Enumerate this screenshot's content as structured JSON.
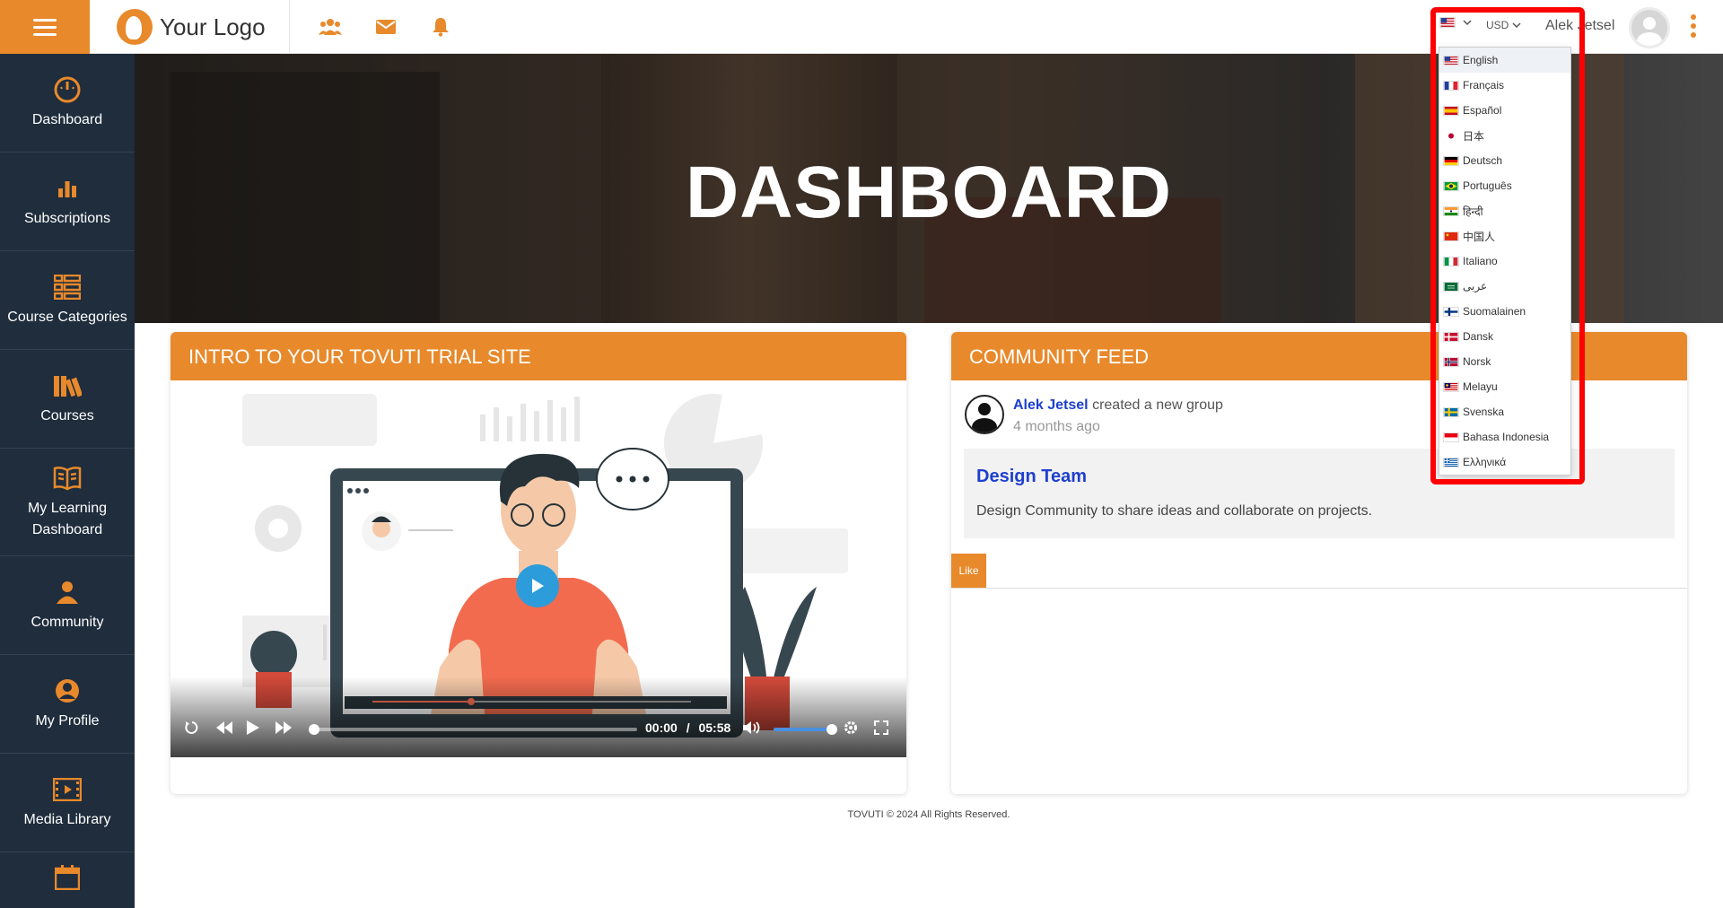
{
  "topbar": {
    "menu_label": "Menu",
    "logo_text": "Your Logo",
    "language_flag": "us-flag",
    "currency": "USD",
    "user_name": "Alek Jetsel"
  },
  "sidebar": {
    "items": [
      {
        "label": "Dashboard",
        "icon": "dashboard-icon"
      },
      {
        "label": "Subscriptions",
        "icon": "bar-chart-icon"
      },
      {
        "label": "Course Categories",
        "icon": "list-icon"
      },
      {
        "label": "Courses",
        "icon": "books-icon"
      },
      {
        "label": "My Learning Dashboard",
        "icon": "open-book-icon"
      },
      {
        "label": "Community",
        "icon": "community-icon"
      },
      {
        "label": "My Profile",
        "icon": "user-circle-icon"
      },
      {
        "label": "Media Library",
        "icon": "film-icon"
      }
    ]
  },
  "hero": {
    "title": "DASHBOARD"
  },
  "intro_card": {
    "title": "INTRO TO YOUR TOVUTI TRIAL SITE",
    "video": {
      "current_time": "00:00",
      "duration": "05:58",
      "separator": "/",
      "progress": 0,
      "volume": 1
    }
  },
  "feed_card": {
    "title": "COMMUNITY FEED",
    "author": "Alek Jetsel",
    "action": "created a new group",
    "time_ago": "4 months ago",
    "group_title": "Design Team",
    "group_description": "Design Community to share ideas and collaborate on projects.",
    "like_label": "Like"
  },
  "footer": {
    "text": "TOVUTI © 2024 All Rights Reserved."
  },
  "language_dropdown": {
    "items": [
      {
        "label": "English",
        "flag": "us-flag"
      },
      {
        "label": "Français",
        "flag": "fr-flag"
      },
      {
        "label": "Español",
        "flag": "es-flag"
      },
      {
        "label": "日本",
        "flag": "jp-flag"
      },
      {
        "label": "Deutsch",
        "flag": "de-flag"
      },
      {
        "label": "Português",
        "flag": "br-flag"
      },
      {
        "label": "हिन्दी",
        "flag": "in-flag"
      },
      {
        "label": "中国人",
        "flag": "cn-flag"
      },
      {
        "label": "Italiano",
        "flag": "it-flag"
      },
      {
        "label": "عربى",
        "flag": "sa-flag"
      },
      {
        "label": "Suomalainen",
        "flag": "fi-flag"
      },
      {
        "label": "Dansk",
        "flag": "dk-flag"
      },
      {
        "label": "Norsk",
        "flag": "no-flag"
      },
      {
        "label": "Melayu",
        "flag": "my-flag"
      },
      {
        "label": "Svenska",
        "flag": "se-flag"
      },
      {
        "label": "Bahasa Indonesia",
        "flag": "id-flag"
      },
      {
        "label": "Ελληνικά",
        "flag": "gr-flag"
      }
    ]
  },
  "colors": {
    "accent": "#e8892b",
    "sidebar": "#1f2d3d",
    "link": "#1e3fcf",
    "highlight": "#ff0000"
  }
}
